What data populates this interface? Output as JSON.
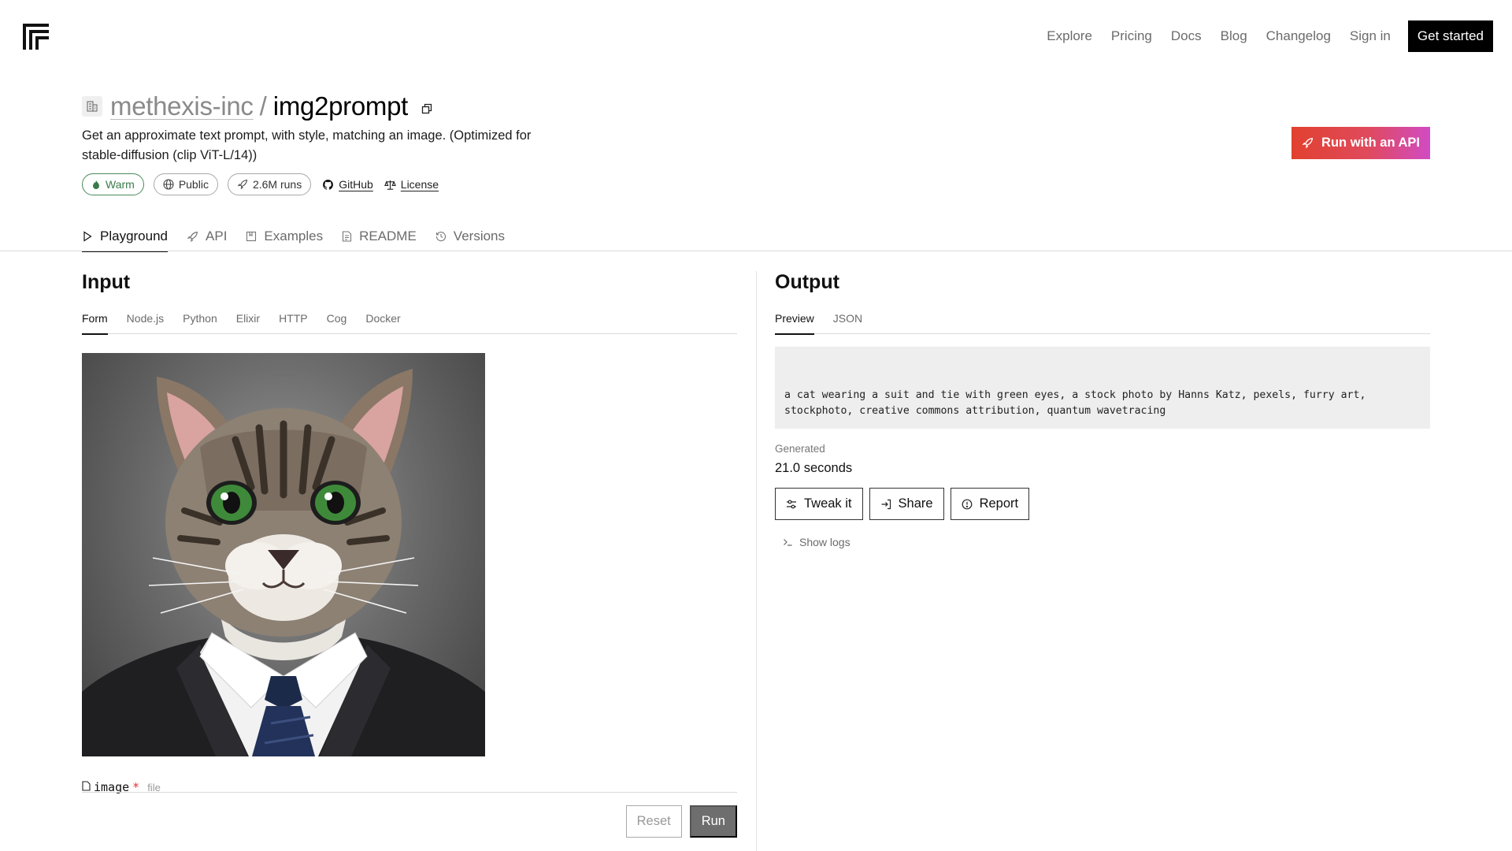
{
  "nav": {
    "links": [
      "Explore",
      "Pricing",
      "Docs",
      "Blog",
      "Changelog",
      "Sign in"
    ],
    "cta": "Get started"
  },
  "model": {
    "owner": "methexis-inc",
    "separator": "/",
    "name": "img2prompt",
    "description": "Get an approximate text prompt, with style, matching an image. (Optimized for stable-diffusion (clip ViT-L/14))",
    "chips": {
      "status": "Warm",
      "visibility": "Public",
      "runs": "2.6M runs",
      "github": "GitHub",
      "license": "License"
    },
    "run_api": "Run with an API"
  },
  "tabs": {
    "playground": "Playground",
    "api": "API",
    "examples": "Examples",
    "readme": "README",
    "versions": "Versions"
  },
  "input": {
    "title": "Input",
    "tabs": [
      "Form",
      "Node.js",
      "Python",
      "Elixir",
      "HTTP",
      "Cog",
      "Docker"
    ],
    "active_tab": "Form",
    "image_description": "cat wearing a suit and tie",
    "field": {
      "name": "image",
      "required_mark": "*",
      "type": "file"
    },
    "reset": "Reset",
    "run": "Run"
  },
  "output": {
    "title": "Output",
    "tabs": [
      "Preview",
      "JSON"
    ],
    "active_tab": "Preview",
    "text": "a cat wearing a suit and tie with green eyes, a stock photo by Hanns Katz, pexels, furry art, stockphoto, creative commons attribution, quantum wavetracing",
    "generated_label": "Generated",
    "generated_value": "21.0 seconds",
    "tweak": "Tweak it",
    "share": "Share",
    "report": "Report",
    "show_logs": "Show logs"
  },
  "colors": {
    "accent_gradient_start": "#e1412f",
    "accent_gradient_end": "#d14bc4",
    "warm_green": "#3a7a4a",
    "run_button": "#6e6e6e"
  }
}
